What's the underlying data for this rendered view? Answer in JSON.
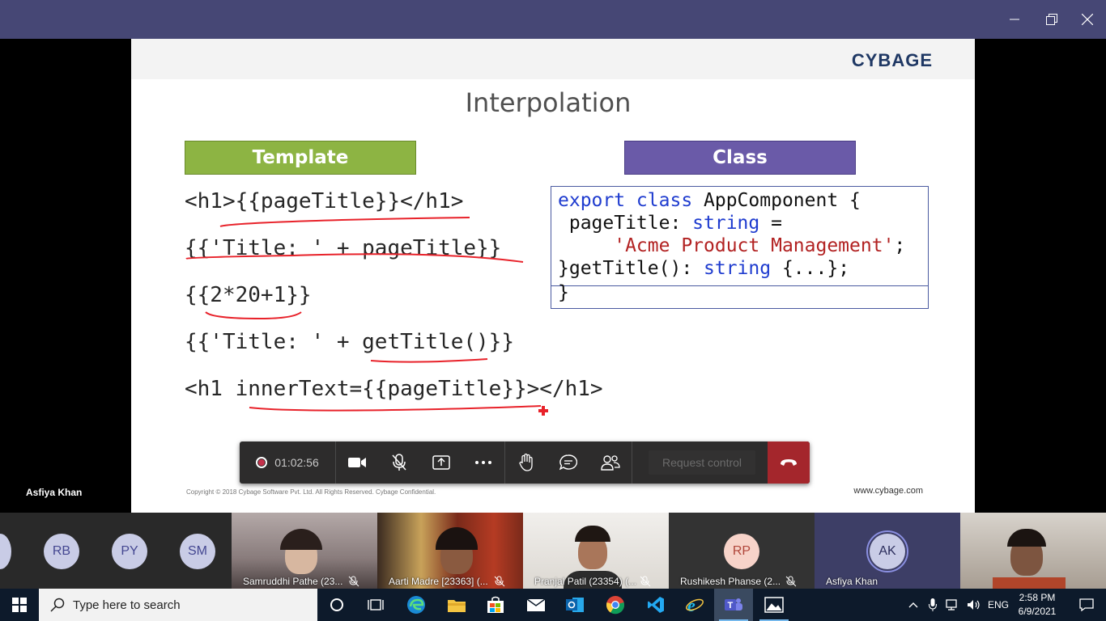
{
  "window": {
    "controls": [
      "minimize",
      "restore",
      "close"
    ]
  },
  "slide": {
    "logo": "CYBAGE",
    "title": "Interpolation",
    "template_label": "Template",
    "class_label": "Class",
    "template_lines": [
      "<h1>{{pageTitle}}</h1>",
      "{{'Title: ' + pageTitle}}",
      "{{2*20+1}}",
      "{{'Title: ' + getTitle()}}",
      "<h1 innerText={{pageTitle}}></h1>"
    ],
    "class_code": {
      "line1_kw": "export class",
      "line1_rest": " AppComponent {",
      "line2_prop": " pageTitle: ",
      "line2_type": "string",
      "line2_rest": " =",
      "line3_str": "     'Acme Product Management'",
      "line3_rest": ";",
      "line4_a": "}getTitle(): ",
      "line4_type": "string",
      "line4_rest": " {...};",
      "line5": "}"
    },
    "copyright": "Copyright © 2018 Cybage Software Pvt. Ltd. All Rights Reserved. Cybage Confidential.",
    "url": "www.cybage.com"
  },
  "presenter_name": "Asfiya Khan",
  "meeting_controls": {
    "timer": "01:02:56",
    "request_control": "Request control",
    "buttons": [
      "camera-icon",
      "mic-off-icon",
      "share-screen-icon",
      "more-icon",
      "raise-hand-icon",
      "chat-icon",
      "participants-icon",
      "hang-up-icon"
    ]
  },
  "participants": {
    "avatars": [
      {
        "initials": "RB"
      },
      {
        "initials": "PY"
      },
      {
        "initials": "SM"
      }
    ],
    "video_tiles": [
      {
        "name": "Samruddhi Pathe (23..."
      },
      {
        "name": "Aarti Madre [23363] (..."
      },
      {
        "name": "Pranjal Patil (23354) (..."
      },
      {
        "name": "Rushikesh Phanse (2...",
        "initials": "RP"
      },
      {
        "name": "Asfiya Khan",
        "initials": "AK"
      }
    ]
  },
  "taskbar": {
    "search_placeholder": "Type here to search",
    "language": "ENG",
    "time": "2:58 PM",
    "date": "6/9/2021"
  },
  "colors": {
    "titlebar": "#464775",
    "template_green": "#8db443",
    "class_purple": "#6a5aa8",
    "ink_red": "#e8222a",
    "hangup_red": "#a4262c"
  }
}
